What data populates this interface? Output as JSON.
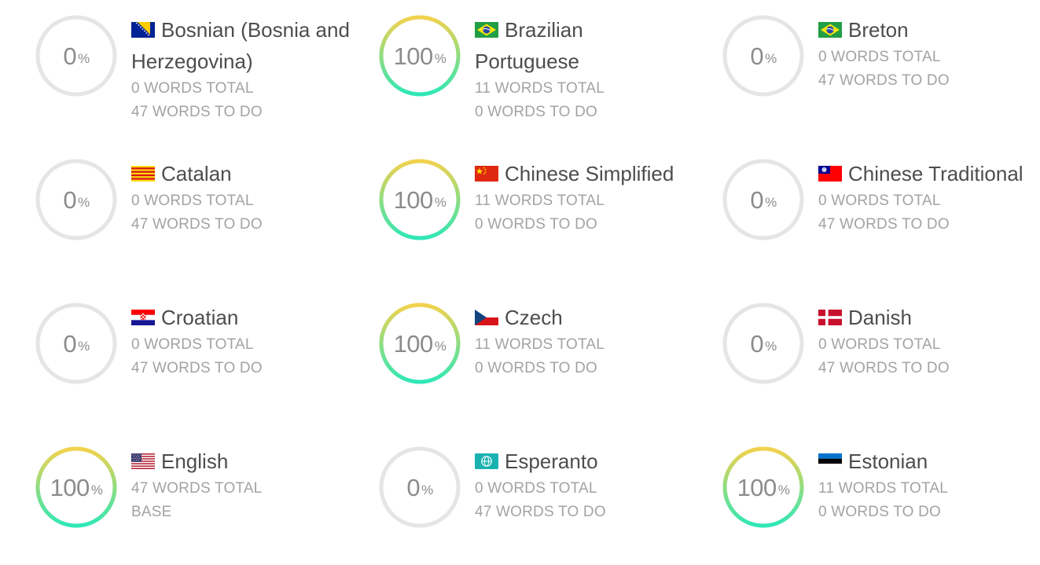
{
  "colors": {
    "ring_track": "#e5e5e5",
    "ring_gradient_start": "#2ee8b6",
    "ring_gradient_end": "#f2d24c",
    "percent_text": "#8c8c8c",
    "name_text": "#4d4d4d",
    "stat_text": "#a3a3a3"
  },
  "languages": [
    {
      "name": "Bosnian (Bosnia and Herzegovina)",
      "percent": 0,
      "percent_label": "0",
      "percent_sign": "%",
      "line1": "0 WORDS TOTAL",
      "line2": "47 WORDS TO DO",
      "flag_icon": "bosnia-flag-icon"
    },
    {
      "name": "Brazilian Portuguese",
      "percent": 100,
      "percent_label": "100",
      "percent_sign": "%",
      "line1": "11 WORDS TOTAL",
      "line2": "0 WORDS TO DO",
      "flag_icon": "brazil-flag-icon"
    },
    {
      "name": "Breton",
      "percent": 0,
      "percent_label": "0",
      "percent_sign": "%",
      "line1": "0 WORDS TOTAL",
      "line2": "47 WORDS TO DO",
      "flag_icon": "brazil-flag-icon"
    },
    {
      "name": "Catalan",
      "percent": 0,
      "percent_label": "0",
      "percent_sign": "%",
      "line1": "0 WORDS TOTAL",
      "line2": "47 WORDS TO DO",
      "flag_icon": "catalonia-flag-icon"
    },
    {
      "name": "Chinese Simplified",
      "percent": 100,
      "percent_label": "100",
      "percent_sign": "%",
      "line1": "11 WORDS TOTAL",
      "line2": "0 WORDS TO DO",
      "flag_icon": "china-flag-icon"
    },
    {
      "name": "Chinese Traditional",
      "percent": 0,
      "percent_label": "0",
      "percent_sign": "%",
      "line1": "0 WORDS TOTAL",
      "line2": "47 WORDS TO DO",
      "flag_icon": "taiwan-flag-icon"
    },
    {
      "name": "Croatian",
      "percent": 0,
      "percent_label": "0",
      "percent_sign": "%",
      "line1": "0 WORDS TOTAL",
      "line2": "47 WORDS TO DO",
      "flag_icon": "croatia-flag-icon"
    },
    {
      "name": "Czech",
      "percent": 100,
      "percent_label": "100",
      "percent_sign": "%",
      "line1": "11 WORDS TOTAL",
      "line2": "0 WORDS TO DO",
      "flag_icon": "czech-flag-icon"
    },
    {
      "name": "Danish",
      "percent": 0,
      "percent_label": "0",
      "percent_sign": "%",
      "line1": "0 WORDS TOTAL",
      "line2": "47 WORDS TO DO",
      "flag_icon": "denmark-flag-icon"
    },
    {
      "name": "English",
      "percent": 100,
      "percent_label": "100",
      "percent_sign": "%",
      "line1": "47 WORDS TOTAL",
      "line2": "BASE",
      "flag_icon": "usa-flag-icon"
    },
    {
      "name": "Esperanto",
      "percent": 0,
      "percent_label": "0",
      "percent_sign": "%",
      "line1": "0 WORDS TOTAL",
      "line2": "47 WORDS TO DO",
      "flag_icon": "esperanto-flag-icon"
    },
    {
      "name": "Estonian",
      "percent": 100,
      "percent_label": "100",
      "percent_sign": "%",
      "line1": "11 WORDS TOTAL",
      "line2": "0 WORDS TO DO",
      "flag_icon": "estonia-flag-icon"
    }
  ]
}
